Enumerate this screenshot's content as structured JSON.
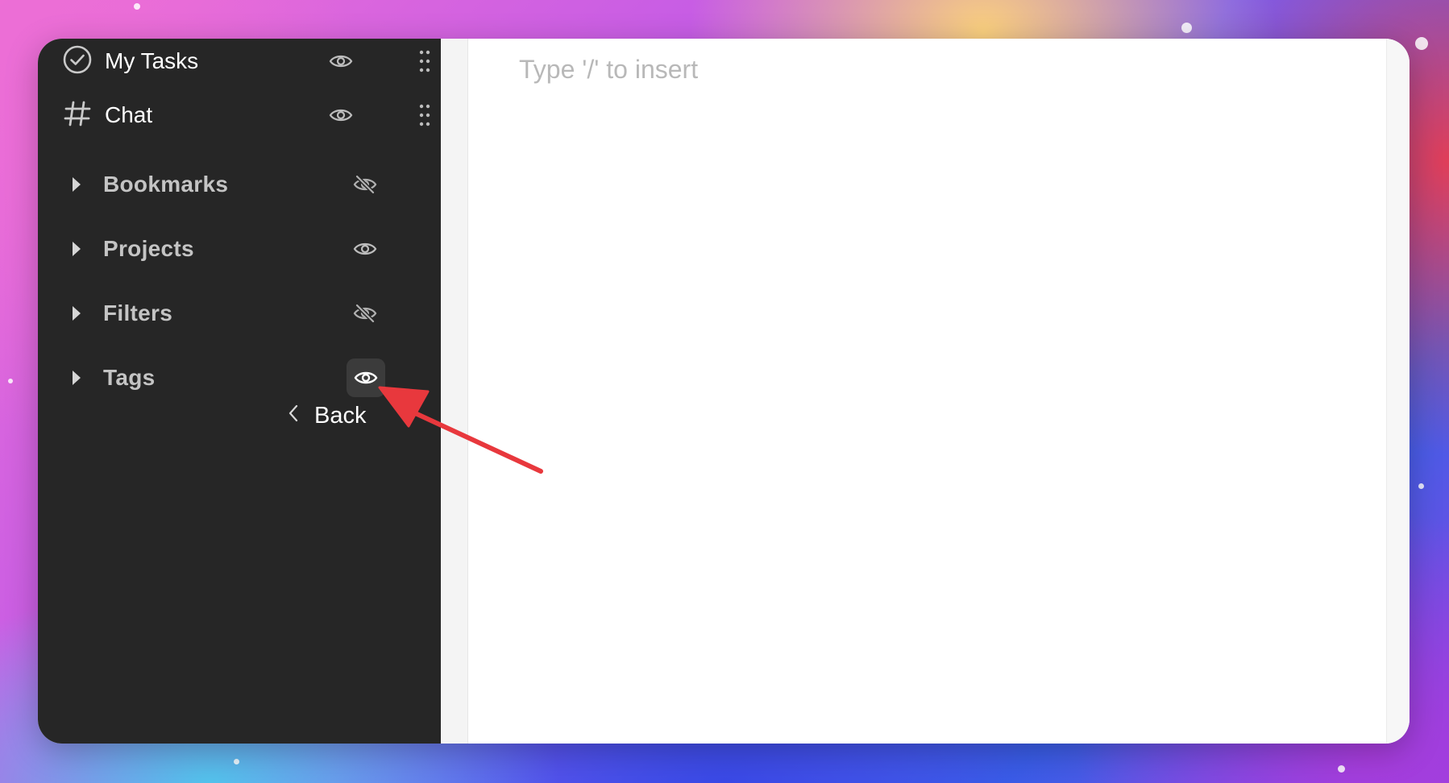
{
  "sidebar": {
    "pinned": [
      {
        "label": "My Tasks",
        "icon": "check-circle-icon",
        "visibility": "visible"
      },
      {
        "label": "Chat",
        "icon": "hash-icon",
        "visibility": "visible"
      }
    ],
    "sections": [
      {
        "label": "Bookmarks",
        "expanded": false,
        "visibility": "hidden",
        "icon": "eye-off-icon"
      },
      {
        "label": "Projects",
        "expanded": false,
        "visibility": "visible",
        "icon": "eye-icon"
      },
      {
        "label": "Filters",
        "expanded": false,
        "visibility": "hidden",
        "icon": "eye-off-icon"
      },
      {
        "label": "Tags",
        "expanded": false,
        "visibility": "visible",
        "icon": "eye-icon",
        "highlighted": true
      }
    ],
    "back_label": "Back"
  },
  "editor": {
    "placeholder": "Type '/' to insert"
  },
  "annotation": {
    "type": "arrow",
    "color": "#e8383d",
    "points_to": "Tags visibility toggle"
  },
  "colors": {
    "sidebar_bg": "#262626",
    "active_button_bg": "#3b3b3b",
    "section_label": "#c4c4c4",
    "placeholder": "#b8b8b8",
    "arrow": "#e8383d"
  }
}
